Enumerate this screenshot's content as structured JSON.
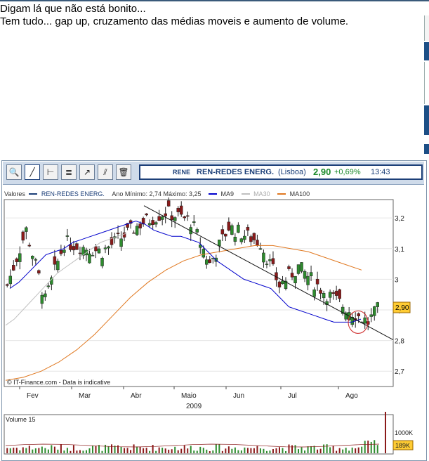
{
  "post": {
    "line1": "Digam lá que não está bonito...",
    "line2": "Tem tudo... gap up, cruzamento das médias moveis e aumento de volume."
  },
  "toolbar": {
    "symbol": "RENE",
    "name": "REN-REDES ENERG.",
    "exchange": "(Lisboa)",
    "price": "2,90",
    "change": "+0,69%",
    "time": "13:43"
  },
  "legend": {
    "valores": "Valores",
    "series_name": "REN-REDES ENERG.",
    "range": "Ano Mínimo: 2,74 Máximo: 3,25",
    "ma9": "MA9",
    "ma30": "MA30",
    "ma100": "MA100"
  },
  "colors": {
    "up": "#2e8b2e",
    "down": "#8b1a1a",
    "ma9": "#0000cc",
    "ma30": "#c0c0c0",
    "ma100": "#e07820",
    "price_box": "#ffcc33",
    "toolbar_bg": "#cfdbea"
  },
  "chart_data": {
    "type": "candlestick",
    "yticks": [
      "3,2",
      "3,1",
      "3",
      "2,9",
      "2,8",
      "2,7"
    ],
    "ylim": [
      2.65,
      3.26
    ],
    "months": [
      "Fev",
      "Mar",
      "Abr",
      "Maio",
      "Jun",
      "Jul",
      "Ago"
    ],
    "year": "2009",
    "last_price_label": "2,90",
    "credit": "© IT-Finance.com - Data is indicative",
    "volume_label": "Volume 15",
    "volume_ticks": [
      "1000K"
    ],
    "volume_last": "189K",
    "ma9": [
      2.97,
      2.99,
      3.02,
      3.05,
      3.08,
      3.09,
      3.1,
      3.12,
      3.13,
      3.14,
      3.15,
      3.16,
      3.17,
      3.18,
      3.19,
      3.18,
      3.16,
      3.15,
      3.14,
      3.14,
      3.13,
      3.12,
      3.09,
      3.06,
      3.04,
      3.02,
      3.0,
      2.99,
      2.98,
      2.97,
      2.94,
      2.91,
      2.9,
      2.89,
      2.88,
      2.87,
      2.86,
      2.86,
      2.86,
      2.87
    ],
    "ma30": [
      2.85,
      2.87,
      2.9,
      2.93,
      2.96,
      2.99,
      3.02,
      3.04,
      3.06,
      3.08,
      3.1,
      3.12,
      3.13,
      3.14,
      3.15
    ],
    "ma100": [
      2.67,
      2.68,
      2.7,
      2.73,
      2.77,
      2.82,
      2.88,
      2.94,
      2.99,
      3.03,
      3.06,
      3.08,
      3.09,
      3.1,
      3.11,
      3.11,
      3.1,
      3.09,
      3.07,
      3.05,
      3.03
    ],
    "trendline": [
      3.24,
      2.83
    ]
  }
}
